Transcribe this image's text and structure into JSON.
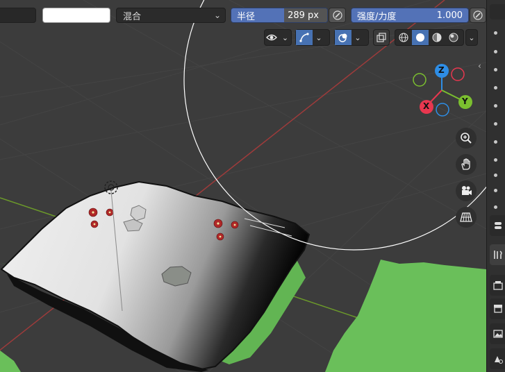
{
  "toolbar": {
    "blend_mode": "混合",
    "radius_label": "半径",
    "radius_value": "289 px",
    "strength_label": "强度/力度",
    "strength_value": "1.000",
    "strength_fraction": 1.0
  },
  "viewport_header": {
    "shading_modes": [
      "wireframe",
      "solid",
      "material-preview",
      "rendered"
    ],
    "active_shading": "solid"
  },
  "gizmo": {
    "x_label": "X",
    "y_label": "Y",
    "z_label": "Z",
    "colors": {
      "x": "#e8374f",
      "y": "#7bbf2f",
      "z": "#2e8ee6"
    }
  },
  "colors": {
    "accent": "#4772b3",
    "grid_x_axis": "#9e3b3b",
    "grid_y_axis": "#6c9a2a",
    "ground": "#6abf5a"
  }
}
